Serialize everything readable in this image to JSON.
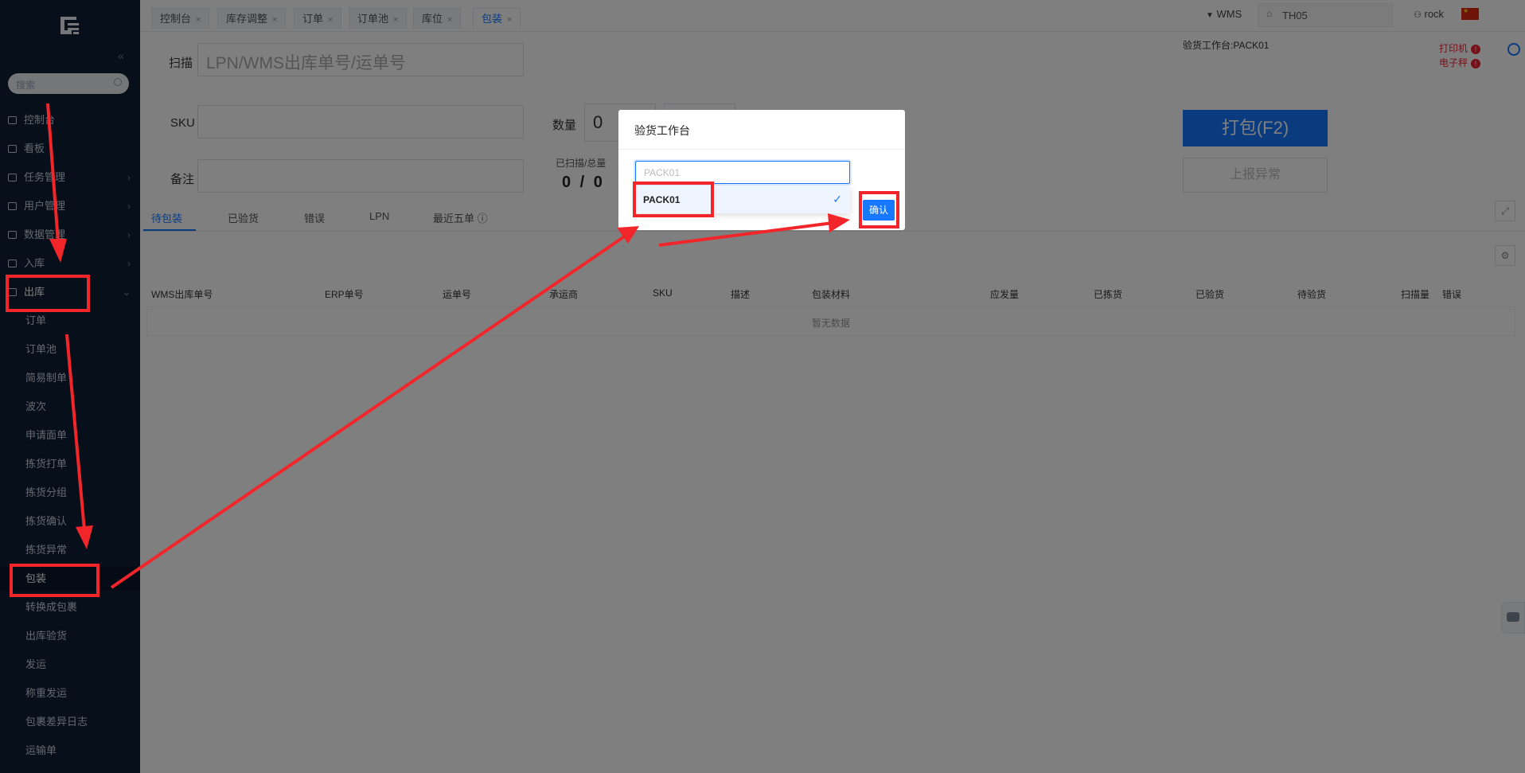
{
  "sidebar": {
    "collapse_glyph": "«",
    "search_placeholder": "搜索",
    "nav_items": [
      {
        "label": "控制台",
        "icon": "rocket-icon"
      },
      {
        "label": "看板",
        "icon": "bar-chart-icon"
      },
      {
        "label": "任务管理",
        "icon": "task-icon",
        "arrow": "›"
      },
      {
        "label": "用户管理",
        "icon": "users-icon",
        "arrow": "›"
      },
      {
        "label": "数据管理",
        "icon": "database-icon",
        "arrow": "›"
      },
      {
        "label": "入库",
        "icon": "cart-icon",
        "arrow": "›"
      },
      {
        "label": "出库",
        "icon": "outbound-icon",
        "arrow": "⌄"
      }
    ],
    "sub_items": [
      "订单",
      "订单池",
      "简易制单",
      "波次",
      "申请面单",
      "拣货打单",
      "拣货分组",
      "拣货确认",
      "拣货异常",
      "包装",
      "转换成包裹",
      "出库验货",
      "发运",
      "称重发运",
      "包裹差异日志",
      "运输单"
    ]
  },
  "tabs": [
    {
      "label": "控制台",
      "close": "×"
    },
    {
      "label": "库存调整",
      "close": "×"
    },
    {
      "label": "订单",
      "close": "×"
    },
    {
      "label": "订单池",
      "close": "×"
    },
    {
      "label": "库位",
      "close": "×"
    },
    {
      "label": "包装",
      "close": "×",
      "active": true
    }
  ],
  "topbar": {
    "system": "WMS",
    "warehouse": "TH05",
    "user": "rock"
  },
  "form": {
    "scan_label": "扫描",
    "scan_placeholder": "LPN/WMS出库单号/运单号",
    "sku_label": "SKU",
    "remark_label": "备注",
    "qty_label": "数量",
    "qty_value": "0",
    "scanned_label": "已扫描/总量",
    "scanned_value": "0 / 0"
  },
  "right_panel": {
    "station_info": "验货工作台:PACK01",
    "printer": "打印机",
    "scale": "电子秤",
    "alert_glyph": "!",
    "pack_button": "打包(F2)",
    "report_button": "上报异常"
  },
  "page_tabs": [
    "待包装",
    "已验货",
    "错误",
    "LPN",
    "最近五单 ⓘ"
  ],
  "table": {
    "columns": [
      "WMS出库单号",
      "ERP单号",
      "运单号",
      "承运商",
      "SKU",
      "描述",
      "包装材料",
      "应发量",
      "已拣货",
      "已验货",
      "待验货",
      "扫描量",
      "错误"
    ],
    "empty_text": "暂无数据"
  },
  "modal": {
    "title": "验货工作台",
    "select_placeholder": "PACK01",
    "option": "PACK01",
    "check": "✓",
    "confirm": "确认"
  },
  "colors": {
    "primary": "#1677ff",
    "sidebar_bg": "#0f1e36",
    "annotation": "#f2262a",
    "alert": "#e23"
  }
}
